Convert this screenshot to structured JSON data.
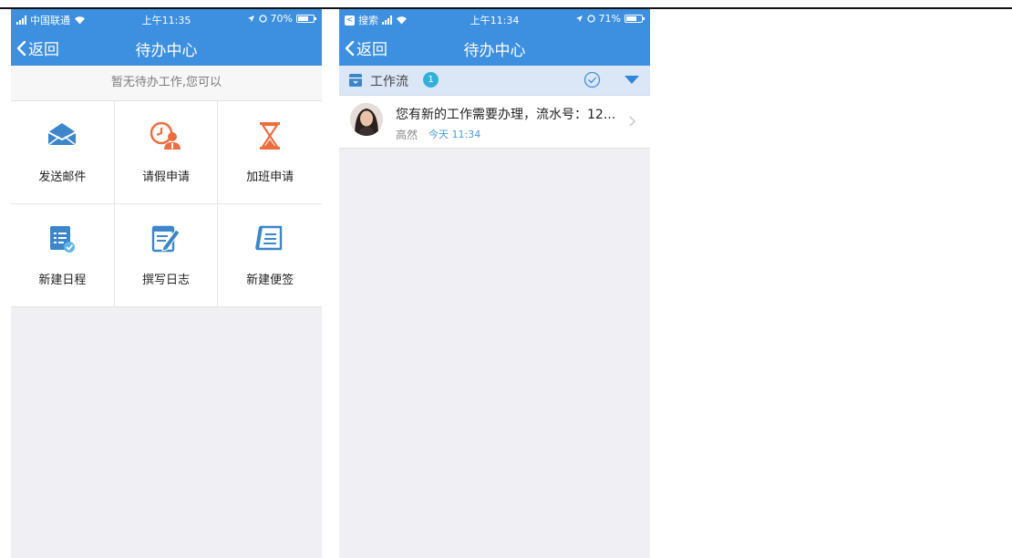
{
  "colors": {
    "accent": "#3d8fe0",
    "badge": "#32b0d9",
    "mail_icon": "#3d86c9",
    "orange_icon": "#ec6e3e",
    "time_text": "#4a9ae0"
  },
  "left_screen": {
    "status": {
      "carrier": "中国联通",
      "time": "上午11:35",
      "battery": "70%",
      "battery_level": 0.7
    },
    "nav": {
      "back_label": "返回",
      "title": "待办中心"
    },
    "hint": "暂无待办工作,您可以",
    "actions": [
      {
        "label": "发送邮件",
        "icon": "mail-icon"
      },
      {
        "label": "请假申请",
        "icon": "clock-person-icon"
      },
      {
        "label": "加班申请",
        "icon": "hourglass-icon"
      },
      {
        "label": "新建日程",
        "icon": "schedule-list-icon"
      },
      {
        "label": "撰写日志",
        "icon": "notepad-pen-icon"
      },
      {
        "label": "新建便签",
        "icon": "note-icon"
      }
    ]
  },
  "right_screen": {
    "status": {
      "back_app": "搜索",
      "time": "上午11:34",
      "battery": "71%",
      "battery_level": 0.71
    },
    "nav": {
      "back_label": "返回",
      "title": "待办中心"
    },
    "workflow": {
      "label": "工作流",
      "count": "1"
    },
    "items": [
      {
        "message": "您有新的工作需要办理，流水号：12...",
        "sender": "高然",
        "time": "今天 11:34"
      }
    ]
  }
}
